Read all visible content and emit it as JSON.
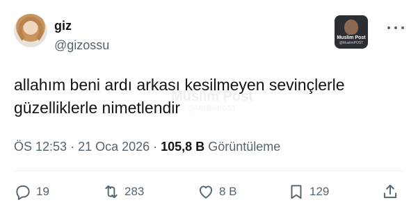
{
  "author": {
    "display_name": "giz",
    "handle": "@gizossu"
  },
  "brand": {
    "title": "Muslim Post",
    "handle": "@MuslimPOST"
  },
  "tweet": {
    "text_line1": "allahım beni ardı arkası kesilmeyen sevinçlerle",
    "text_line2": "güzelliklerle nimetlendir"
  },
  "meta": {
    "time": "ÖS 12:53",
    "separator1": " · ",
    "date": "21 Oca 2026",
    "separator2": " · ",
    "views_count": "105,8 B",
    "views_label": " Görüntüleme"
  },
  "actions": {
    "replies": "19",
    "retweets": "283",
    "likes": "8 B",
    "bookmarks": "129"
  },
  "icons": {
    "reply": "reply-icon",
    "retweet": "retweet-icon",
    "like": "heart-icon",
    "bookmark": "bookmark-icon",
    "share": "share-icon",
    "more": "more-icon"
  },
  "colors": {
    "text_primary": "#0f1419",
    "text_secondary": "#536471",
    "divider": "#eff3f4"
  }
}
